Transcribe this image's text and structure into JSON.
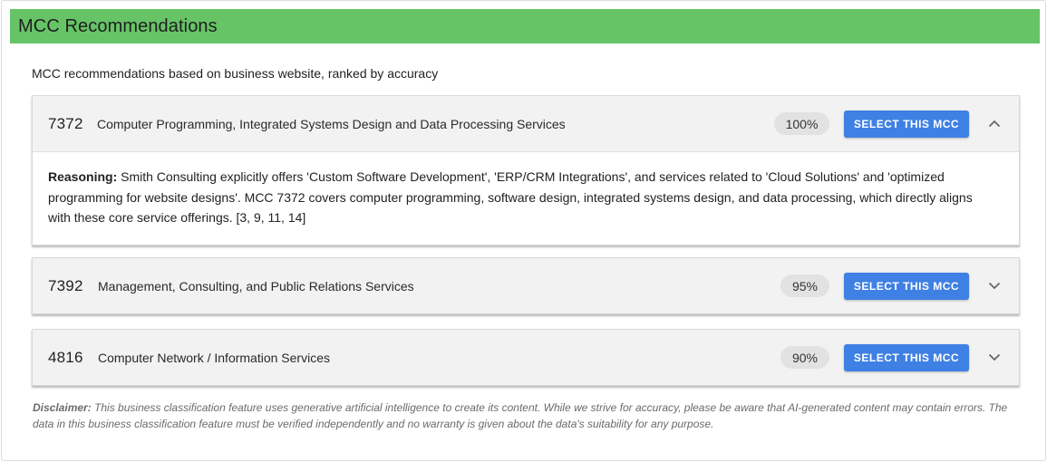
{
  "header": {
    "title": "MCC Recommendations"
  },
  "subtitle": "MCC recommendations based on business website, ranked by accuracy",
  "recommendations": [
    {
      "code": "7372",
      "description": "Computer Programming, Integrated Systems Design and Data Processing Services",
      "accuracy": "100%",
      "button_label": "SELECT THIS MCC",
      "expanded": true,
      "reasoning_label": "Reasoning:",
      "reasoning": "Smith Consulting explicitly offers 'Custom Software Development', 'ERP/CRM Integrations', and services related to 'Cloud Solutions' and 'optimized programming for website designs'. MCC 7372 covers computer programming, software design, integrated systems design, and data processing, which directly aligns with these core service offerings. [3, 9, 11, 14]"
    },
    {
      "code": "7392",
      "description": "Management, Consulting, and Public Relations Services",
      "accuracy": "95%",
      "button_label": "SELECT THIS MCC",
      "expanded": false
    },
    {
      "code": "4816",
      "description": "Computer Network / Information Services",
      "accuracy": "90%",
      "button_label": "SELECT THIS MCC",
      "expanded": false
    }
  ],
  "disclaimer": {
    "label": "Disclaimer:",
    "text": "This business classification feature uses generative artificial intelligence to create its content. While we strive for accuracy, please be aware that AI-generated content may contain errors. The data in this business classification feature must be verified independently and no warranty is given about the data's suitability for any purpose."
  },
  "colors": {
    "header_bg": "#66c466",
    "button_bg": "#3f80e4",
    "badge_bg": "#e2e2e2",
    "panel_head_bg": "#f2f2f2"
  },
  "icons": {
    "expanded": "chevron-up-icon",
    "collapsed": "chevron-down-icon"
  }
}
